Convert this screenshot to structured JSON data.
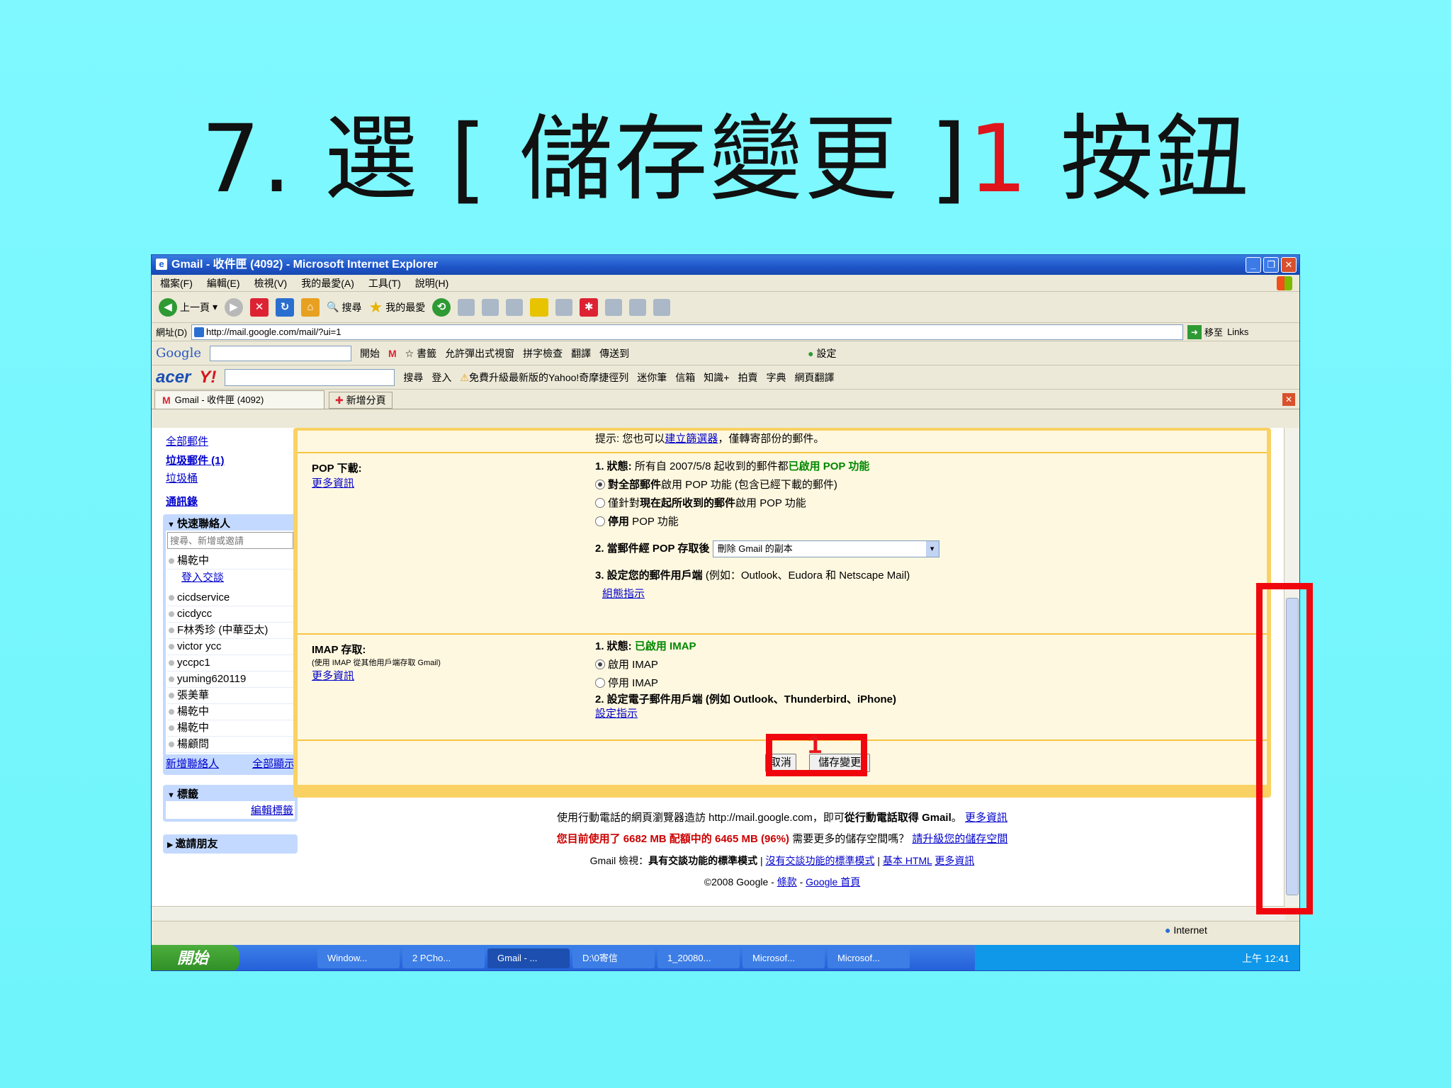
{
  "slide": {
    "title_prefix": "7. 選 [ 儲存變更 ]",
    "title_num": "1",
    "title_suffix": " 按鈕"
  },
  "window": {
    "title": "Gmail - 收件匣 (4092) - Microsoft Internet Explorer"
  },
  "menu": [
    "檔案(F)",
    "編輯(E)",
    "檢視(V)",
    "我的最愛(A)",
    "工具(T)",
    "說明(H)"
  ],
  "toolbar": {
    "back": "上一頁",
    "search": "搜尋",
    "favorites": "我的最愛"
  },
  "address": {
    "label": "網址(D)",
    "url": "http://mail.google.com/mail/?ui=1",
    "go": "移至",
    "links": "Links"
  },
  "googlebar": {
    "logo": "Google",
    "start": "開始",
    "bookmarks": "書籤",
    "popup": "允許彈出式視窗",
    "spell": "拼字檢查",
    "translate": "翻譯",
    "sendto": "傳送到",
    "settings": "設定"
  },
  "acerbar": {
    "logo": "acer",
    "yahoo": "Y!",
    "search": "搜尋",
    "login": "登入",
    "upgrade": "免費升級最新版的Yahoo!奇摩捷徑列",
    "pixnet": "迷你筆",
    "mail": "信箱",
    "know": "知識+",
    "auction": "拍賣",
    "dict": "字典",
    "webtrans": "網頁翻譯"
  },
  "tabs": {
    "current": "Gmail - 收件匣 (4092)",
    "new": "新增分頁"
  },
  "sidebar": {
    "links": [
      "全部郵件",
      "垃圾郵件 (1)",
      "垃圾桶"
    ],
    "contacts_link": "通訊錄",
    "quick_header": "快速聯絡人",
    "quick_search": "搜尋、新增或邀請",
    "me": "楊乾中",
    "chat_login": "登入交談",
    "contacts": [
      "cicdservice",
      "cicdycc",
      "F林秀珍 (中華亞太)",
      "victor ycc",
      "yccpc1",
      "yuming620119",
      "張美華",
      "楊乾中",
      "楊乾中",
      "楊顧問"
    ],
    "add_contact": "新增聯絡人",
    "show_all": "全部顯示",
    "labels_header": "標籤",
    "edit_labels": "編輯標籤",
    "invite_header": "邀請朋友"
  },
  "settings": {
    "hint_prefix": "提示: 您也可以",
    "hint_link": "建立篩選器",
    "hint_suffix": "，僅轉寄部份的郵件。",
    "pop_label": "POP 下載:",
    "more": "更多資訊",
    "pop_status_prefix": "1. 狀態:",
    "pop_status_text": " 所有自 2007/5/8 起收到的郵件都",
    "pop_status_enabled": "已啟用 POP 功能",
    "pop_opt1_bold": "對全部郵件",
    "pop_opt1_rest": "啟用 POP 功能 (包含已經下載的郵件)",
    "pop_opt2_pre": "僅針對",
    "pop_opt2_bold": "現在起所收到的郵件",
    "pop_opt2_rest": "啟用 POP 功能",
    "pop_opt3_bold": "停用",
    "pop_opt3_rest": " POP 功能",
    "pop_step2": "2. 當郵件經 POP 存取後",
    "pop_step2_value": "刪除 Gmail 的副本",
    "pop_step3": "3. 設定您的郵件用戶端",
    "pop_step3_rest": " (例如：Outlook、Eudora 和 Netscape Mail)",
    "config_link": "組態指示",
    "imap_label": "IMAP 存取:",
    "imap_sub": "(使用 IMAP 從其他用戶端存取 Gmail)",
    "imap_status_prefix": "1. 狀態:",
    "imap_status_enabled": "已啟用 IMAP",
    "imap_opt1": "啟用 IMAP",
    "imap_opt2": "停用 IMAP",
    "imap_step2": "2. 設定電子郵件用戶端 (例如 Outlook、Thunderbird、iPhone)",
    "setup_link": "設定指示",
    "cancel": "取消",
    "save": "儲存變更"
  },
  "footer": {
    "mobile_pre": "使用行動電話的網頁瀏覽器造訪 http://mail.google.com，即可",
    "mobile_bold": "從行動電話取得 Gmail",
    "mobile_post": "。",
    "mobile_more": "更多資訊",
    "usage": "您目前使用了 6682 MB 配額中的 6465 MB (96%)",
    "usage_q": " 需要更多的儲存空間嗎？",
    "usage_link": "請升級您的儲存空間",
    "view_pre": "Gmail 檢視：",
    "view_bold": "具有交談功能的標準模式",
    "view_l1": "沒有交談功能的標準模式",
    "view_l2": "基本 HTML",
    "view_l3": "更多資訊",
    "copy": "©2008 Google - ",
    "terms": "條款",
    "home": "Google 首頁"
  },
  "status": {
    "zone": "Internet"
  },
  "taskbar": {
    "start": "開始",
    "tasks": [
      "Window...",
      "2 PCho...",
      "Gmail - ...",
      "D:\\0寄信",
      "1_20080...",
      "Microsof...",
      "Microsof..."
    ],
    "clock": "上午 12:41"
  }
}
